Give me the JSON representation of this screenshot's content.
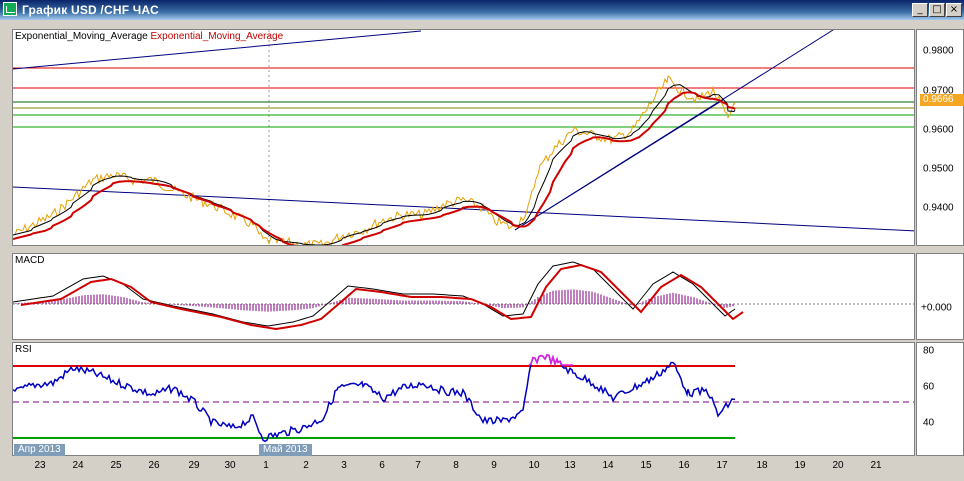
{
  "window": {
    "title": "График USD /CHF ЧАС",
    "minimize": "_",
    "maximize": "□",
    "close": "×"
  },
  "main_pane": {
    "legend_1": "Exponential_Moving_Average",
    "legend_2": "Exponential_Moving_Average",
    "price_ticks": [
      "0.9800",
      "0.9700",
      "0.9600",
      "0.9500",
      "0.9400"
    ],
    "current_price": "0.9666"
  },
  "macd_pane": {
    "label": "MACD",
    "tick": "+0.000"
  },
  "rsi_pane": {
    "label": "RSI",
    "ticks": [
      "80",
      "60",
      "40"
    ]
  },
  "x_axis": {
    "labels": [
      "23",
      "24",
      "25",
      "26",
      "29",
      "30",
      "1",
      "2",
      "3",
      "6",
      "7",
      "8",
      "9",
      "10",
      "13",
      "14",
      "15",
      "16",
      "17",
      "18",
      "19",
      "20",
      "21"
    ],
    "month_start_1": "Апр 2013",
    "month_start_2": "Май 2013"
  },
  "colors": {
    "price": "#e8a000",
    "ema_fast": "#000000",
    "ema_slow": "#d00000",
    "trendline": "#000080",
    "resistance": "#e00000",
    "support": "#00a000",
    "rsi": "#0000c0",
    "rsi_overbought": "#e020e0",
    "macd_hist": "#800080"
  }
}
